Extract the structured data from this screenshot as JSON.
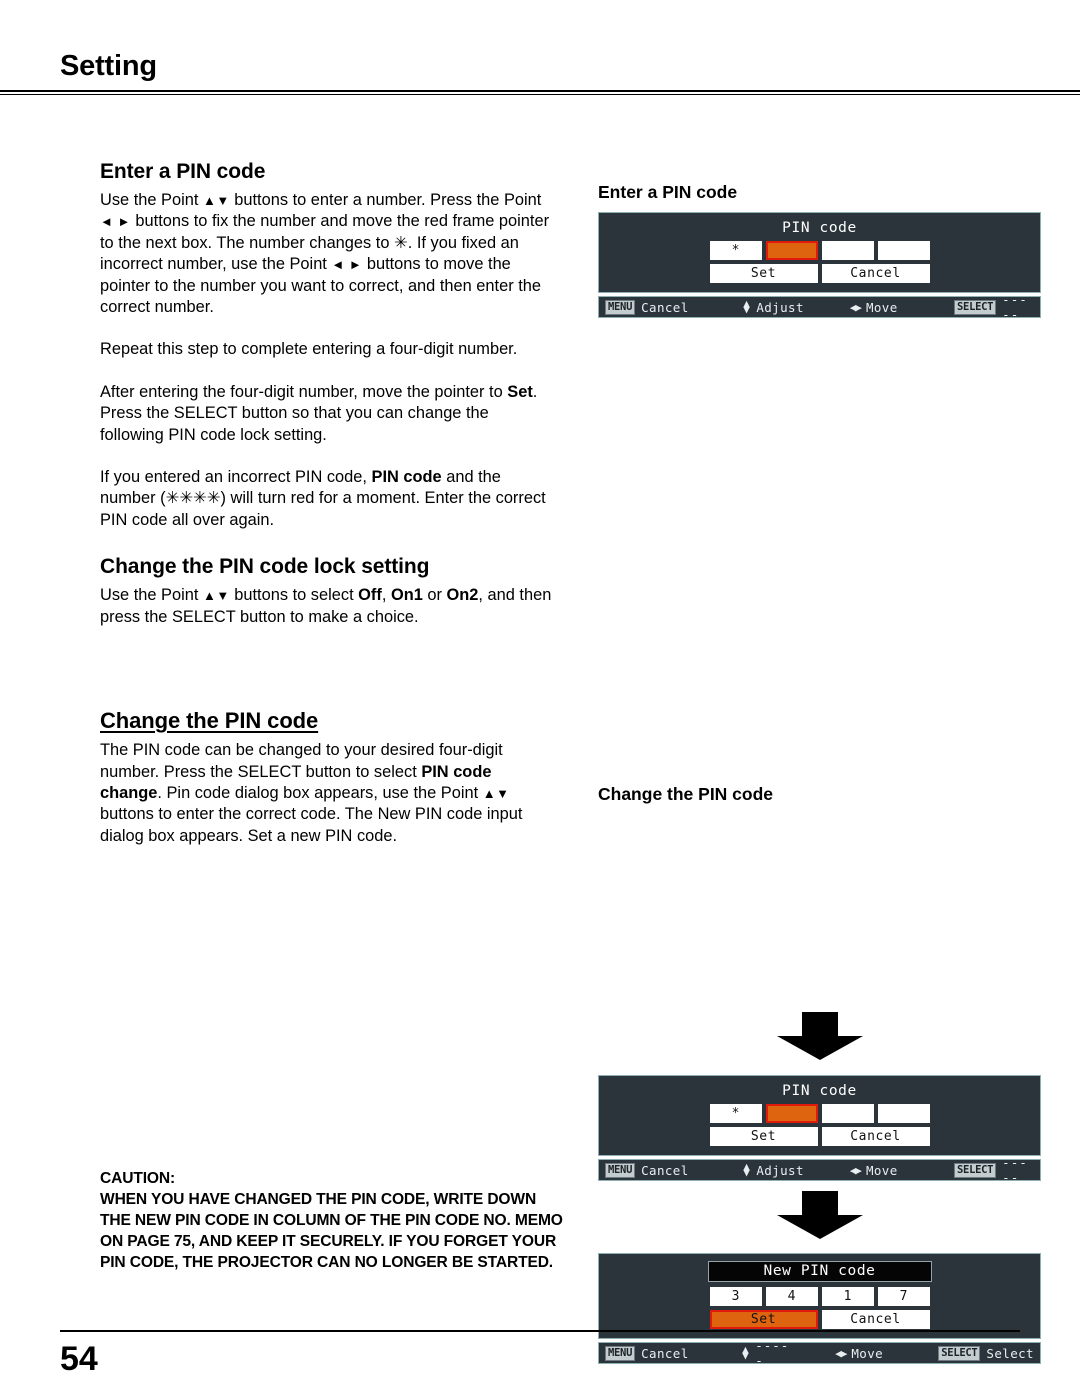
{
  "header": {
    "title": "Setting"
  },
  "left_column": {
    "section1": {
      "heading": "Enter a PIN code",
      "p1_a": "Use the Point ",
      "p1_arrows1": "▲▼",
      "p1_b": " buttons to enter a number. Press the Point ",
      "p1_arrows2": "◄ ►",
      "p1_c": " buttons to fix the number and move the red frame pointer to the next box. The number changes to ✳. If you fixed an incorrect number, use the Point ",
      "p1_arrows3": "◄ ►",
      "p1_d": " buttons to move the pointer to the number you want to correct, and then enter the correct number.",
      "p2": "Repeat this step to complete entering a four-digit number.",
      "p3_a": "After entering the four-digit number, move the pointer to ",
      "p3_bold": "Set",
      "p3_b": ". Press the SELECT button so that you can change the following PIN code lock setting.",
      "p4_a": "If you entered an incorrect PIN code, ",
      "p4_bold": "PIN code",
      "p4_b": " and the number (✳✳✳✳) will turn red for a moment. Enter the correct PIN code all over again."
    },
    "section2": {
      "heading": "Change the PIN code lock setting",
      "p1_a": "Use the Point ",
      "p1_arrows": "▲▼",
      "p1_b": " buttons to select ",
      "opt1": "Off",
      "sep1": ", ",
      "opt2": "On1",
      "sep2": " or ",
      "opt3": "On2",
      "p1_c": ", and then press the SELECT button to make a choice."
    },
    "section3": {
      "heading": "Change the PIN code",
      "p1_a": "The PIN code can be changed to your desired four-digit number. Press the SELECT button to select ",
      "p1_bold1": "PIN code change",
      "p1_b": ". Pin code dialog box appears, use the Point ",
      "p1_arrows": "▲▼",
      "p1_c": " buttons to enter the correct code. The New PIN code input dialog box appears. Set a new PIN code."
    },
    "caution": {
      "title": "CAUTION:",
      "body": "WHEN YOU HAVE CHANGED THE PIN CODE, WRITE DOWN THE NEW PIN CODE IN COLUMN OF THE PIN CODE NO. MEMO ON PAGE 75, AND KEEP IT SECURELY. IF YOU FORGET YOUR PIN CODE, THE PROJECTOR CAN NO LONGER BE STARTED."
    }
  },
  "right_column": {
    "heading1": "Enter a PIN code",
    "heading2": "Change the PIN code",
    "dialog_enter_pin": {
      "title": "PIN code",
      "pin_boxes": [
        "*",
        "",
        "",
        ""
      ],
      "selected_box_index": 1,
      "set_label": "Set",
      "cancel_label": "Cancel",
      "selected_button": "none",
      "status_bar": {
        "menu_badge": "MENU",
        "menu_label": "Cancel",
        "adjust_label": "Adjust",
        "move_label": "Move",
        "select_badge": "SELECT",
        "select_label": "-----"
      }
    },
    "dialog_pin_code_2": {
      "title": "PIN code",
      "pin_boxes": [
        "*",
        "",
        "",
        ""
      ],
      "selected_box_index": 1,
      "set_label": "Set",
      "cancel_label": "Cancel",
      "selected_button": "none",
      "status_bar": {
        "menu_badge": "MENU",
        "menu_label": "Cancel",
        "adjust_label": "Adjust",
        "move_label": "Move",
        "select_badge": "SELECT",
        "select_label": "-----"
      }
    },
    "dialog_new_pin": {
      "title": "New PIN code",
      "pin_boxes": [
        "3",
        "4",
        "1",
        "7"
      ],
      "selected_box_index": -1,
      "set_label": "Set",
      "cancel_label": "Cancel",
      "selected_button": "set",
      "status_bar": {
        "menu_badge": "MENU",
        "menu_label": "Cancel",
        "adjust_label": "-----",
        "move_label": "Move",
        "select_badge": "SELECT",
        "select_label": "Select"
      }
    }
  },
  "footer": {
    "page_number": "54"
  },
  "colors": {
    "osd_panel": "#2b343b",
    "osd_border": "#8fb0b2",
    "highlight_fill": "#de6410",
    "highlight_border": "#e01b0b",
    "badge_bg": "#c3cdd0"
  }
}
